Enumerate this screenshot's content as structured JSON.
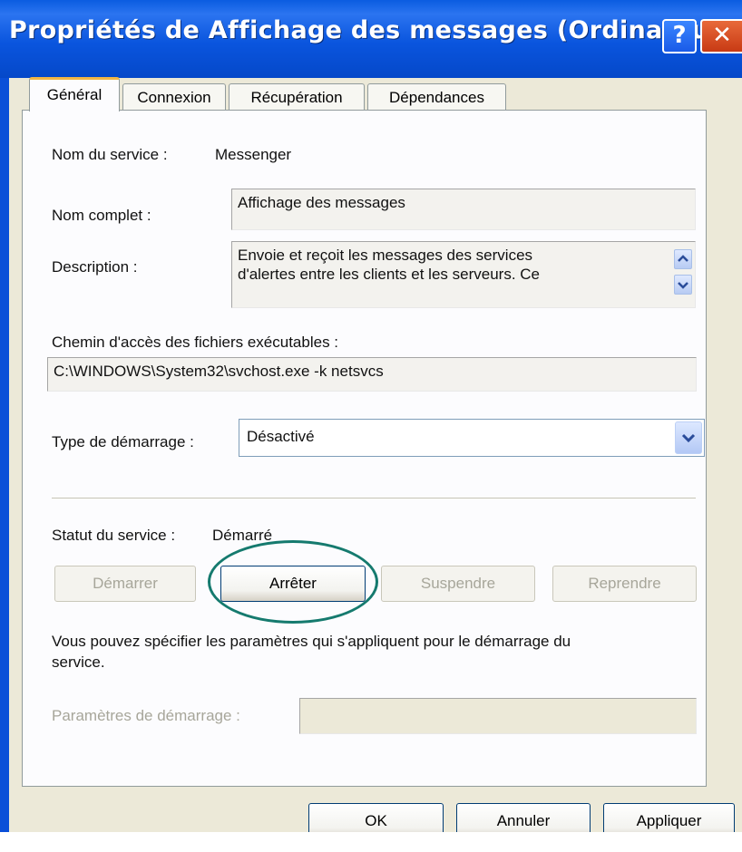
{
  "window": {
    "title": "Propriétés de Affichage des messages (Ordinateur local)"
  },
  "titlebar": {
    "help_glyph": "?",
    "close_glyph": "✕"
  },
  "tabs": [
    {
      "label": "Général"
    },
    {
      "label": "Connexion"
    },
    {
      "label": "Récupération"
    },
    {
      "label": "Dépendances"
    }
  ],
  "general": {
    "service_name_label": "Nom du service :",
    "service_name_value": "Messenger",
    "display_name_label": "Nom complet :",
    "display_name_value": "Affichage des messages",
    "description_label": "Description :",
    "description_line1": "Envoie et reçoit les messages des services",
    "description_line2": "d'alertes entre les clients et les serveurs. Ce",
    "path_label": "Chemin d'accès des fichiers exécutables :",
    "path_value": "C:\\WINDOWS\\System32\\svchost.exe -k netsvcs",
    "startup_type_label": "Type de démarrage :",
    "startup_type_value": "Désactivé",
    "status_label": "Statut du service :",
    "status_value": "Démarré",
    "buttons": {
      "start": "Démarrer",
      "stop": "Arrêter",
      "pause": "Suspendre",
      "resume": "Reprendre"
    },
    "hint_line1": "Vous pouvez spécifier les paramètres qui s'appliquent pour le démarrage du",
    "hint_line2": "service.",
    "start_params_label": "Paramètres de démarrage :",
    "start_params_value": ""
  },
  "footer": {
    "ok": "OK",
    "cancel": "Annuler",
    "apply": "Appliquer"
  },
  "colors": {
    "titlebar": "#0a55de",
    "highlight_circle": "#157a6e",
    "active_tab_accent": "#f2b646"
  },
  "icons": [
    "help-icon",
    "close-icon",
    "scroll-up-icon",
    "scroll-down-icon",
    "dropdown-arrow-icon"
  ]
}
